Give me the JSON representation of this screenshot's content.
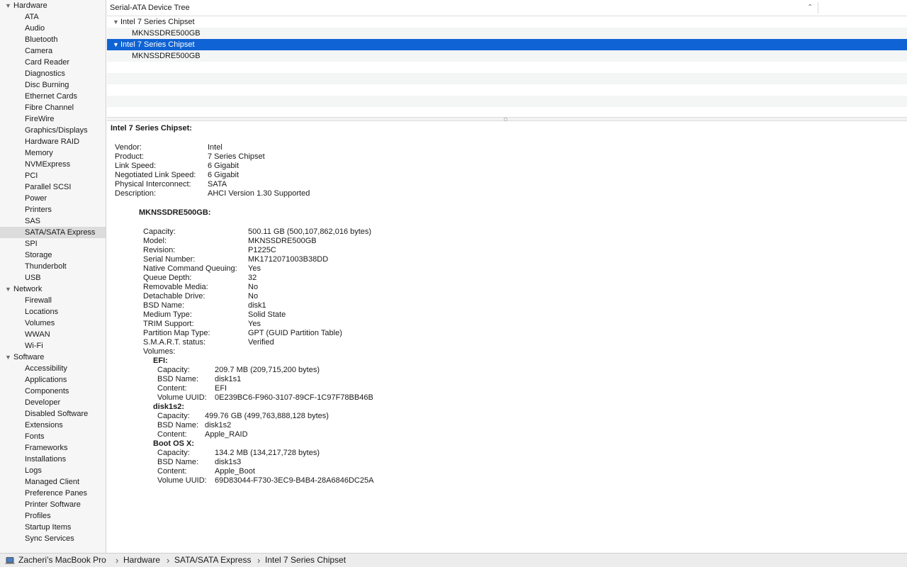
{
  "sidebar": {
    "hardware": {
      "label": "Hardware",
      "items": [
        "ATA",
        "Audio",
        "Bluetooth",
        "Camera",
        "Card Reader",
        "Diagnostics",
        "Disc Burning",
        "Ethernet Cards",
        "Fibre Channel",
        "FireWire",
        "Graphics/Displays",
        "Hardware RAID",
        "Memory",
        "NVMExpress",
        "PCI",
        "Parallel SCSI",
        "Power",
        "Printers",
        "SAS",
        "SATA/SATA Express",
        "SPI",
        "Storage",
        "Thunderbolt",
        "USB"
      ]
    },
    "network": {
      "label": "Network",
      "items": [
        "Firewall",
        "Locations",
        "Volumes",
        "WWAN",
        "Wi-Fi"
      ]
    },
    "software": {
      "label": "Software",
      "items": [
        "Accessibility",
        "Applications",
        "Components",
        "Developer",
        "Disabled Software",
        "Extensions",
        "Fonts",
        "Frameworks",
        "Installations",
        "Logs",
        "Managed Client",
        "Preference Panes",
        "Printer Software",
        "Profiles",
        "Startup Items",
        "Sync Services"
      ]
    },
    "selected": "SATA/SATA Express"
  },
  "tree": {
    "header": "Serial-ATA Device Tree",
    "rows": [
      {
        "label": "Intel 7 Series Chipset",
        "level": 0
      },
      {
        "label": "MKNSSDRE500GB",
        "level": 1
      },
      {
        "label": "Intel 7 Series Chipset",
        "level": 0
      },
      {
        "label": "MKNSSDRE500GB",
        "level": 1
      }
    ]
  },
  "detail": {
    "title": "Intel 7 Series Chipset:",
    "controller": [
      {
        "k": "Vendor:",
        "v": "Intel"
      },
      {
        "k": "Product:",
        "v": "7 Series Chipset"
      },
      {
        "k": "Link Speed:",
        "v": "6 Gigabit"
      },
      {
        "k": "Negotiated Link Speed:",
        "v": "6 Gigabit"
      },
      {
        "k": "Physical Interconnect:",
        "v": "SATA"
      },
      {
        "k": "Description:",
        "v": "AHCI Version 1.30 Supported"
      }
    ],
    "device_title": "MKNSSDRE500GB:",
    "device": [
      {
        "k": "Capacity:",
        "v": "500.11 GB (500,107,862,016 bytes)"
      },
      {
        "k": "Model:",
        "v": "MKNSSDRE500GB"
      },
      {
        "k": "Revision:",
        "v": "P1225C"
      },
      {
        "k": "Serial Number:",
        "v": "MK1712071003B38DD"
      },
      {
        "k": "Native Command Queuing:",
        "v": "Yes"
      },
      {
        "k": "Queue Depth:",
        "v": "32"
      },
      {
        "k": "Removable Media:",
        "v": "No"
      },
      {
        "k": "Detachable Drive:",
        "v": "No"
      },
      {
        "k": "BSD Name:",
        "v": "disk1"
      },
      {
        "k": "Medium Type:",
        "v": "Solid State"
      },
      {
        "k": "TRIM Support:",
        "v": "Yes"
      },
      {
        "k": "Partition Map Type:",
        "v": "GPT (GUID Partition Table)"
      },
      {
        "k": "S.M.A.R.T. status:",
        "v": "Verified"
      },
      {
        "k": "Volumes:",
        "v": ""
      }
    ],
    "volumes": [
      {
        "name": "EFI:",
        "props": [
          {
            "k": "Capacity:",
            "v": "209.7 MB (209,715,200 bytes)"
          },
          {
            "k": "BSD Name:",
            "v": "disk1s1"
          },
          {
            "k": "Content:",
            "v": "EFI"
          },
          {
            "k": "Volume UUID:",
            "v": "0E239BC6-F960-3107-89CF-1C97F78BB46B"
          }
        ]
      },
      {
        "name": "disk1s2:",
        "props": [
          {
            "k": "Capacity:",
            "v": "499.76 GB (499,763,888,128 bytes)"
          },
          {
            "k": "BSD Name:",
            "v": "disk1s2"
          },
          {
            "k": "Content:",
            "v": "Apple_RAID"
          }
        ]
      },
      {
        "name": "Boot OS X:",
        "props": [
          {
            "k": "Capacity:",
            "v": "134.2 MB (134,217,728 bytes)"
          },
          {
            "k": "BSD Name:",
            "v": "disk1s3"
          },
          {
            "k": "Content:",
            "v": "Apple_Boot"
          },
          {
            "k": "Volume UUID:",
            "v": "69D83044-F730-3EC9-B4B4-28A6846DC25A"
          }
        ]
      }
    ]
  },
  "breadcrumb": {
    "items": [
      "Zacheri’s MacBook Pro",
      "Hardware",
      "SATA/SATA Express",
      "Intel 7 Series Chipset"
    ],
    "separator": "›"
  },
  "colors": {
    "selection": "#0f63d4",
    "sidebar_bg": "#f6f6f6",
    "sidebar_selected": "#dcdcdc"
  }
}
